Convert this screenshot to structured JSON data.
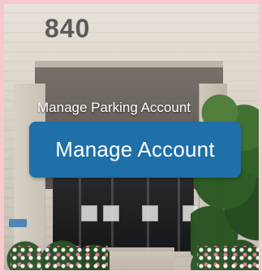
{
  "image": {
    "building_number": "840"
  },
  "overlay": {
    "title": "Manage Parking Account",
    "button_label": "Manage Account"
  }
}
